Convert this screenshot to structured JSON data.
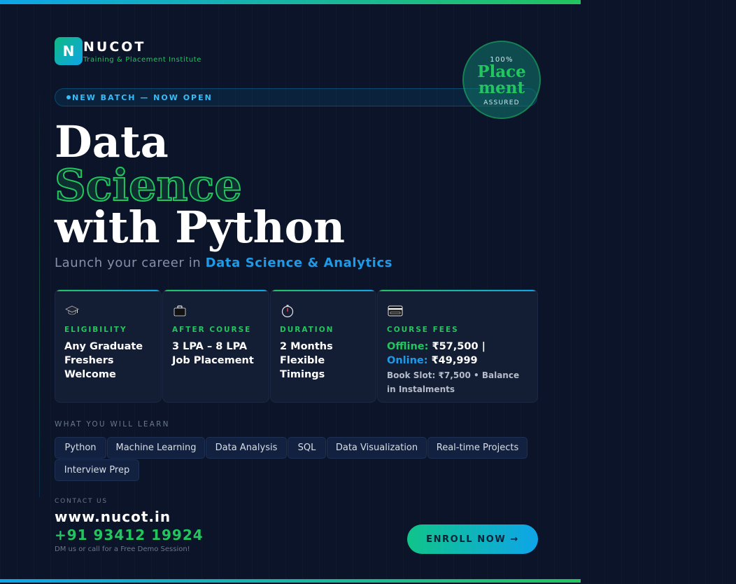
{
  "brand": {
    "logo_letter": "N",
    "name": "NUCOT",
    "tagline": "Training & Placement Institute"
  },
  "badge": {
    "batch_text": "NEW BATCH — NOW OPEN"
  },
  "seal": {
    "top": "100%",
    "main_line1": "Place",
    "main_line2": "ment",
    "bottom": "ASSURED"
  },
  "headline": {
    "line1": "Data",
    "line2": "Science",
    "line3": "with Python"
  },
  "subtitle": {
    "prefix": "Launch your career in ",
    "highlight": "Data Science & Analytics"
  },
  "cards": [
    {
      "label": "ELIGIBILITY",
      "line1": "Any Graduate",
      "line2": "Freshers",
      "line3": "Welcome",
      "icon": "graduation-cap-icon"
    },
    {
      "label": "AFTER COURSE",
      "line1": "3 LPA – 8 LPA",
      "line2": "Job Placement",
      "icon": "briefcase-icon"
    },
    {
      "label": "DURATION",
      "line1": "2 Months",
      "line2": "Flexible Timings",
      "icon": "stopwatch-icon"
    },
    {
      "label": "COURSE FEES",
      "offline_label": "Offline:",
      "offline_value": " ₹57,500  |",
      "online_label": "Online:",
      "online_value": " ₹49,999",
      "note": "Book Slot: ₹7,500 • Balance in Instalments",
      "icon": "credit-card-icon"
    }
  ],
  "learn": {
    "heading": "WHAT YOU WILL LEARN",
    "topics": [
      "Python",
      "Machine Learning",
      "Data Analysis",
      "SQL",
      "Data Visualization",
      "Real-time Projects",
      "Interview Prep"
    ]
  },
  "contact": {
    "heading": "CONTACT US",
    "website": "www.nucot.in",
    "phone": "+91 93412 19924",
    "note": "DM us or call for a Free Demo Session!"
  },
  "cta": {
    "label": "ENROLL NOW →"
  },
  "colors": {
    "background": "#0b1428",
    "accent_green": "#22c55e",
    "accent_blue": "#0ea5e9"
  }
}
